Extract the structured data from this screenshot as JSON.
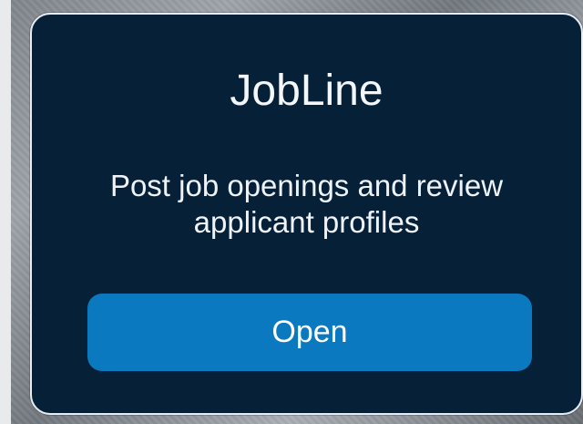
{
  "app": {
    "title": "JobLine",
    "description": "Post job openings and review applicant profiles",
    "button_label": "Open"
  },
  "colors": {
    "card_background": "#062038",
    "accent": "#0b79bf",
    "text": "#f3f6fa",
    "border": "#e7edf5"
  }
}
